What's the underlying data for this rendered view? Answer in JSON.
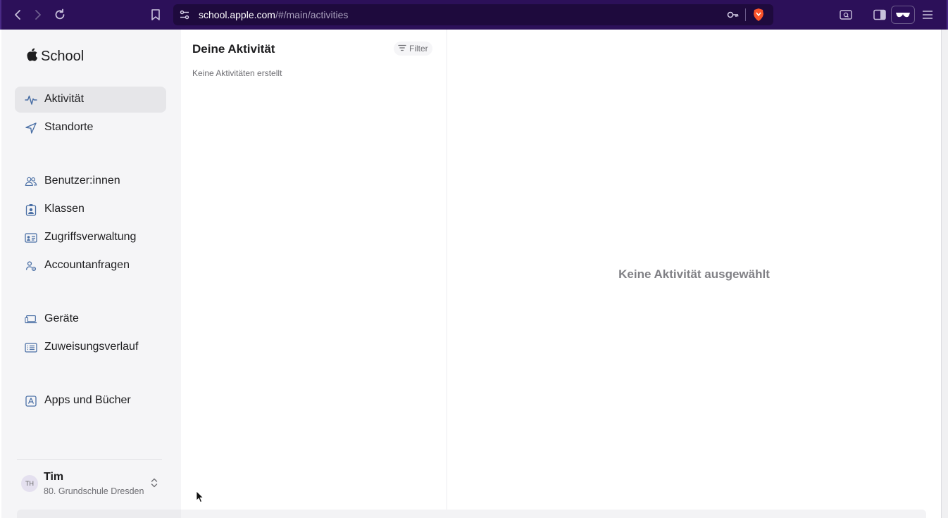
{
  "browser": {
    "url_host": "school.apple.com",
    "url_path": "/#/main/activities"
  },
  "sidebar": {
    "brand": "School",
    "items": [
      {
        "label": "Aktivität",
        "icon": "activity-icon",
        "active": true
      },
      {
        "label": "Standorte",
        "icon": "location-arrow-icon"
      },
      {
        "label": "Benutzer:innen",
        "icon": "people-icon"
      },
      {
        "label": "Klassen",
        "icon": "class-badge-icon"
      },
      {
        "label": "Zugriffsverwaltung",
        "icon": "id-card-icon"
      },
      {
        "label": "Accountanfragen",
        "icon": "person-gear-icon"
      },
      {
        "label": "Geräte",
        "icon": "devices-icon"
      },
      {
        "label": "Zuweisungsverlauf",
        "icon": "list-history-icon"
      },
      {
        "label": "Apps und Bücher",
        "icon": "app-store-icon"
      }
    ],
    "profile": {
      "initials": "TH",
      "name": "Tim",
      "org": "80. Grundschule Dresden"
    }
  },
  "list": {
    "title": "Deine Aktivität",
    "filter_label": "Filter",
    "empty_text": "Keine Aktivitäten erstellt"
  },
  "detail": {
    "empty_text": "Keine Aktivität ausgewählt"
  },
  "colors": {
    "toolbar": "#2c1059",
    "sidebar_bg": "#f5f5f7",
    "active_item": "#e6e6e9",
    "icon_accent": "#4a6fa5",
    "brave_orange": "#fb542b"
  }
}
